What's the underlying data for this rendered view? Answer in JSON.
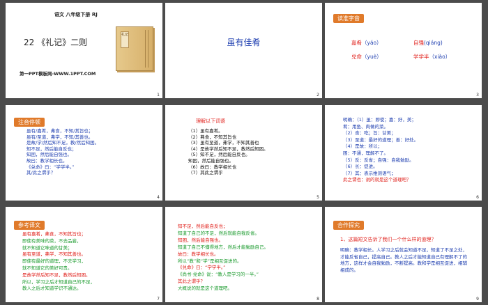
{
  "slides": [
    {
      "number": "1",
      "header": "语文 八年级下册 RJ",
      "title": "22 《礼记》二则",
      "footer": "第一PPT模板网-WWW.1PPT.COM",
      "book_label": "礼记"
    },
    {
      "number": "2",
      "title": "虽有佳肴"
    },
    {
      "number": "3",
      "tag": "读准字音",
      "items": [
        {
          "word": "嘉肴",
          "pinyin": "（yáo）"
        },
        {
          "word": "自强",
          "pinyin": "(qiáng)"
        },
        {
          "word": "兑命",
          "pinyin": "（yuè）"
        },
        {
          "word": "学学半",
          "pinyin": "（xiào）"
        }
      ]
    },
    {
      "number": "4",
      "tag": "注音停顿",
      "lines": [
        "虽有/嘉肴，弗食，不知/其旨也；",
        "虽有/至道，弗学，不知/其善也。",
        "是故/学/然后知不足，教/然后知困。",
        "知不足，然后能自反也；",
        "知困，然后能自强也。",
        "故曰：教学相长也。",
        "《兑命》曰：“学学半。”",
        "其/此之谓乎？"
      ]
    },
    {
      "number": "5",
      "heading": "理解以下词语",
      "lines": [
        "（1）虽有嘉肴。",
        "（2）弗食，不知其旨也",
        "（3）虽有至道，弗学，不知其善也",
        "（4）是故学然后知不足，教然后知困。",
        "（5）知不足，然后能自反也。",
        "    知困，然后能自强也。",
        "（6）故曰：教学相长也",
        "（7）其此之谓乎"
      ]
    },
    {
      "number": "6",
      "lines": [
        "明确：（1）虽：即使；嘉：好，美；",
        "           肴：用鱼、肉做的菜。",
        "（2）食：吃；旨：甘美；",
        "（3）至道：最好的道理；善：好处。",
        "（4）是故：所以；",
        "     困：不通，理解不了。",
        "（5）反：反省；自强：自我勉励。",
        "（6）长：促进。",
        "（7）其：表示推测语气；",
        "此之谓也：说的就是这个道理吧？"
      ]
    },
    {
      "number": "7",
      "tag": "参考译文",
      "lines": [
        "虽有嘉肴，弗食，不知其旨也；",
        "即使有美味的菜，不去品尝，",
        "就不知道它味道的甘美；",
        "虽有至道，弗学，不知其善也。",
        "即使有最好的道理，不去学习，",
        "就不知道它的美好可贵。",
        "是故学然后知不足，教然后知困。",
        "所以，学习之后才知道自己的不足，",
        "教人之后才知道学识不通达。"
      ]
    },
    {
      "number": "8",
      "lines": [
        "知不足，然后能自反也；",
        "知道了自己的不足，然后就能自我反省。",
        "知困，然后能自强也。",
        "知道了自己不懂得地方，然后才能勉励自己。",
        "故曰：教学相长也。",
        "所以“教”和“学”是相互促进的。",
        "《兑命》曰：“学学半。”",
        "《尚书·兑命》说：“教人是学习的一半。”",
        "其此之谓乎？",
        "大概说的就是这个道理吧。"
      ]
    },
    {
      "number": "9",
      "tag": "合作探究",
      "question": "1、这篇短文告诉了我们一个什么样的道理？",
      "answer": "明确：教学相长。人学习之后就会知道不足，知道了不足之处，才能反省自己，提高自己。教人之后才能知道自己有理解不了的地方，这样才会自我勉励，不断提高。教和学是相互促进，相辅相成的。"
    }
  ]
}
